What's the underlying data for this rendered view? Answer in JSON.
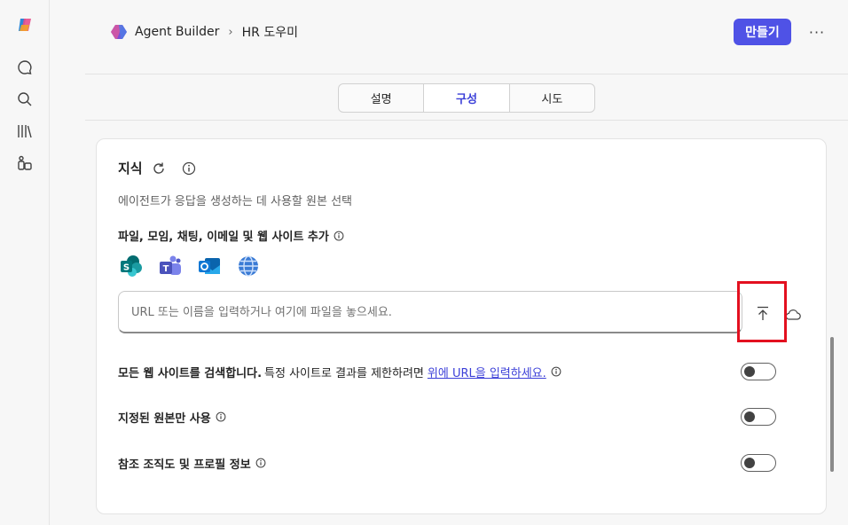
{
  "breadcrumb": {
    "app": "Agent Builder",
    "current": "HR 도우미"
  },
  "header": {
    "create_label": "만들기",
    "more_label": "···"
  },
  "tabs": [
    {
      "label": "설명",
      "active": false
    },
    {
      "label": "구성",
      "active": true
    },
    {
      "label": "시도",
      "active": false
    }
  ],
  "knowledge": {
    "title": "지식",
    "description": "에이전트가 응답을 생성하는 데 사용할 원본 선택",
    "add_label": "파일, 모임, 채팅, 이메일 및 웹 사이트 추가",
    "sources": [
      "sharepoint-icon",
      "teams-icon",
      "outlook-icon",
      "web-globe-icon"
    ],
    "url_placeholder": "URL 또는 이름을 입력하거나 여기에 파일을 놓으세요.",
    "url_value": ""
  },
  "settings": [
    {
      "label": "모든 웹 사이트를 검색합니다.",
      "extra": "특정 사이트로 결과를 제한하려면",
      "link": "위에 URL을 입력하세요.",
      "enabled": false
    },
    {
      "label": "지정된 원본만 사용",
      "enabled": false
    },
    {
      "label": "참조 조직도 및 프로필 정보",
      "enabled": false
    }
  ],
  "colors": {
    "accent": "#4f52e6",
    "tab_active": "#3b3fd8",
    "highlight": "#e3101f"
  }
}
